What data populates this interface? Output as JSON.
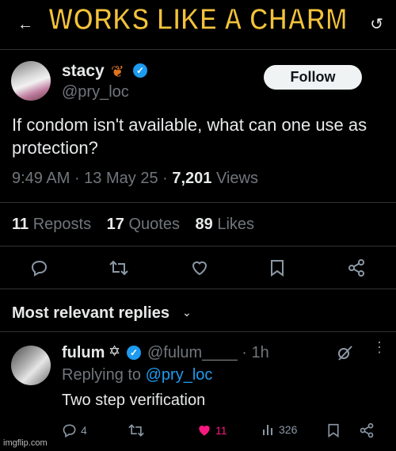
{
  "caption": "WORKS LIKE A CHARM",
  "tweet": {
    "author_name": "stacy",
    "author_handle": "@pry_loc",
    "follow_label": "Follow",
    "text": "If condom isn't available, what can one use as protection?",
    "time": "9:49 AM",
    "date": "13 May 25",
    "views_count": "7,201",
    "views_label": "Views",
    "reposts_count": "11",
    "reposts_label": "Reposts",
    "quotes_count": "17",
    "quotes_label": "Quotes",
    "likes_count": "89",
    "likes_label": "Likes"
  },
  "replies_header": "Most relevant replies",
  "reply": {
    "author_name": "fulum",
    "author_handle": "@fulum____",
    "time": "1h",
    "replying_prefix": "Replying to",
    "replying_handle": "@pry_loc",
    "text": "Two step verification",
    "replies_count": "4",
    "likes_count": "11",
    "views_count": "326"
  },
  "watermark": "imgflip.com",
  "icons": {
    "back": "back-arrow-icon",
    "more": "more-icon",
    "leaf": "leaf-emoji-icon",
    "verified": "verified-badge-icon",
    "reply": "reply-icon",
    "repost": "repost-icon",
    "like": "heart-icon",
    "bookmark": "bookmark-icon",
    "share": "share-icon",
    "grok": "grok-icon",
    "views": "views-icon"
  },
  "colors": {
    "background": "#000000",
    "text": "#e7e9ea",
    "muted": "#71767b",
    "accent": "#1d9bf0",
    "like_pink": "#f91880",
    "caption_yellow": "#f2c23a"
  }
}
